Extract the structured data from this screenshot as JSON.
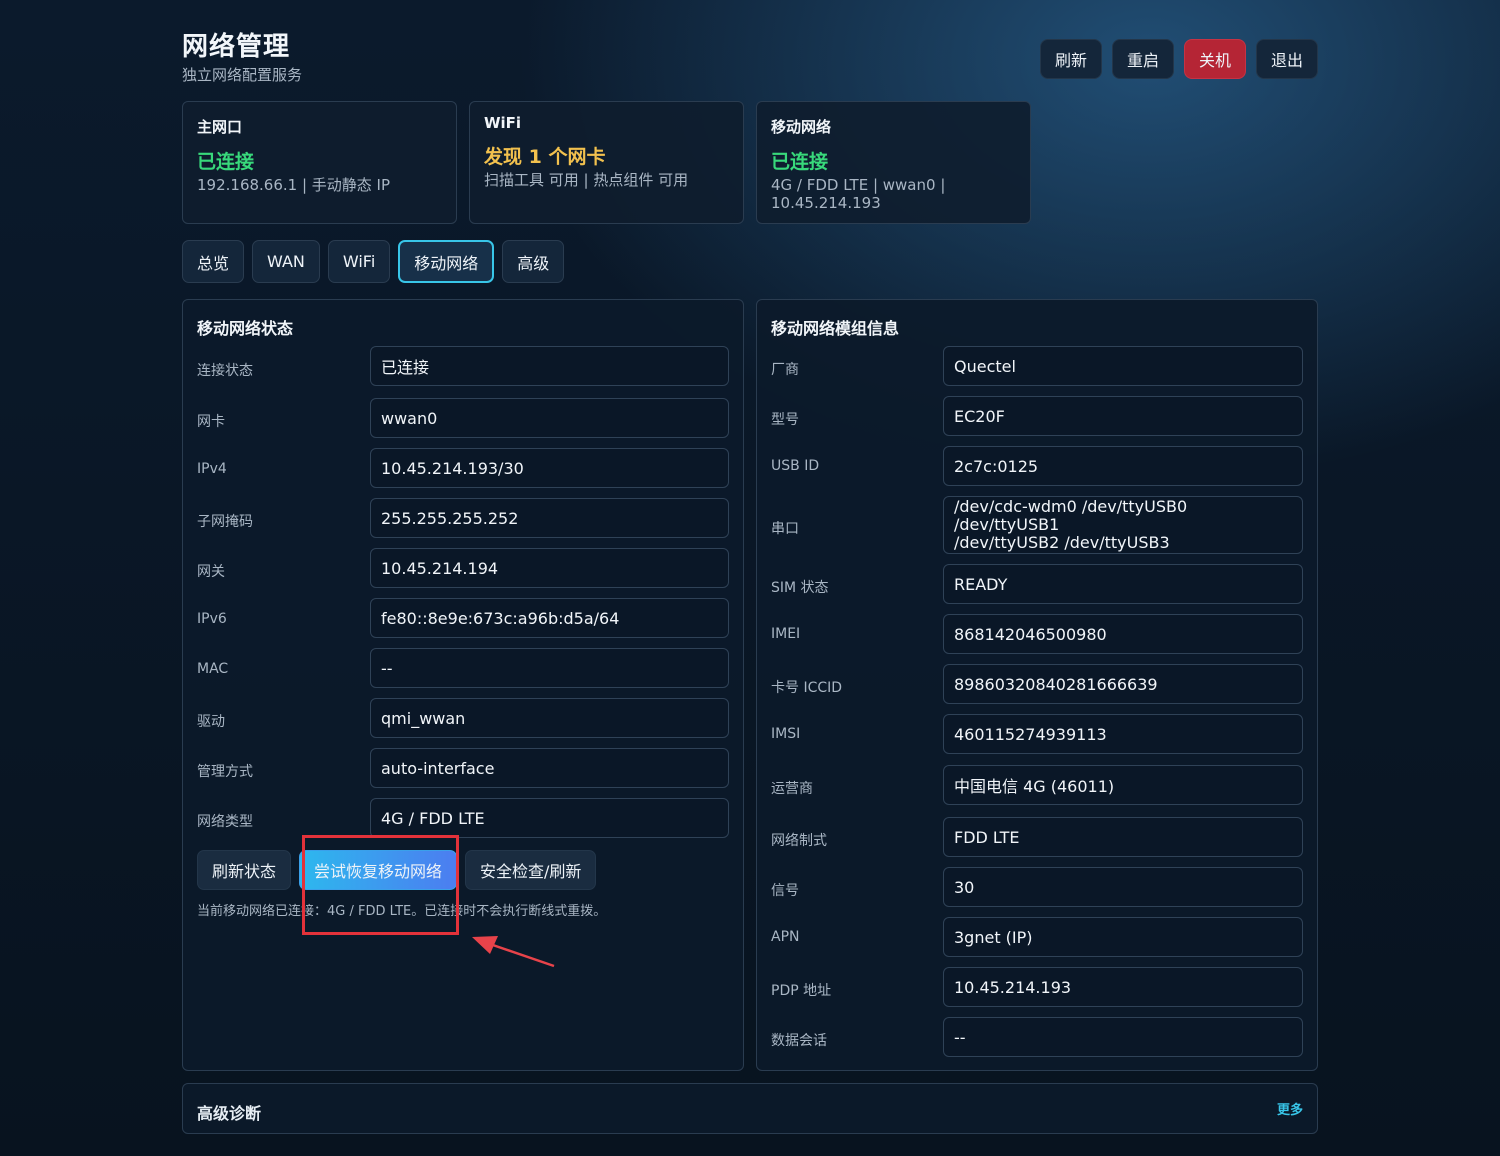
{
  "header": {
    "title": "网络管理",
    "subtitle": "独立网络配置服务",
    "actions": [
      "刷新",
      "重启",
      "关机",
      "退出"
    ]
  },
  "summary": {
    "main": {
      "title": "主网口",
      "status": "已连接",
      "detail": "192.168.66.1 | 手动静态 IP"
    },
    "wifi": {
      "title": "WiFi",
      "status": "发现 1 个网卡",
      "detail": "扫描工具 可用 | 热点组件 可用"
    },
    "mobile": {
      "title": "移动网络",
      "status": "已连接",
      "detail_line1": "4G / FDD LTE | wwan0 |",
      "detail_line2": "10.45.214.193"
    }
  },
  "tabs": [
    "总览",
    "WAN",
    "WiFi",
    "移动网络",
    "高级"
  ],
  "active_tab": "移动网络",
  "left_panel": {
    "title": "移动网络状态",
    "rows": [
      {
        "label": "连接状态",
        "value": "已连接"
      },
      {
        "label": "网卡",
        "value": "wwan0"
      },
      {
        "label": "IPv4",
        "value": "10.45.214.193/30"
      },
      {
        "label": "子网掩码",
        "value": "255.255.255.252"
      },
      {
        "label": "网关",
        "value": "10.45.214.194"
      },
      {
        "label": "IPv6",
        "value": "fe80::8e9e:673c:a96b:d5a/64"
      },
      {
        "label": "MAC",
        "value": "--"
      },
      {
        "label": "驱动",
        "value": "qmi_wwan"
      },
      {
        "label": "管理方式",
        "value": "auto-interface"
      },
      {
        "label": "网络类型",
        "value": "4G / FDD LTE"
      }
    ],
    "buttons": [
      "刷新状态",
      "尝试恢复移动网络",
      "安全检查/刷新"
    ],
    "hint": "当前移动网络已连接：4G / FDD LTE。已连接时不会执行断线式重拨。"
  },
  "right_panel": {
    "title": "移动网络模组信息",
    "rows": [
      {
        "label": "厂商",
        "value": "Quectel"
      },
      {
        "label": "型号",
        "value": "EC20F"
      },
      {
        "label": "USB ID",
        "value": "2c7c:0125"
      },
      {
        "label": "串口",
        "value_line1": "/dev/cdc-wdm0 /dev/ttyUSB0 /dev/ttyUSB1",
        "value_line2": "/dev/ttyUSB2 /dev/ttyUSB3"
      },
      {
        "label": "SIM 状态",
        "value": "READY"
      },
      {
        "label": "IMEI",
        "value": "868142046500980"
      },
      {
        "label": "卡号 ICCID",
        "value": "89860320840281666639"
      },
      {
        "label": "IMSI",
        "value": "460115274939113"
      },
      {
        "label": "运营商",
        "value": "中国电信 4G (46011)"
      },
      {
        "label": "网络制式",
        "value": "FDD LTE"
      },
      {
        "label": "信号",
        "value": "30"
      },
      {
        "label": "APN",
        "value": "3gnet (IP)"
      },
      {
        "label": "PDP 地址",
        "value": "10.45.214.193"
      },
      {
        "label": "数据会话",
        "value": "--"
      }
    ]
  },
  "advanced": {
    "title": "高级诊断",
    "more": "更多"
  },
  "colors": {
    "ok": "#38d97b",
    "warn": "#f2c14e",
    "danger": "#b52535",
    "accent": "#38c5e8",
    "highlight": "#e3323a"
  }
}
